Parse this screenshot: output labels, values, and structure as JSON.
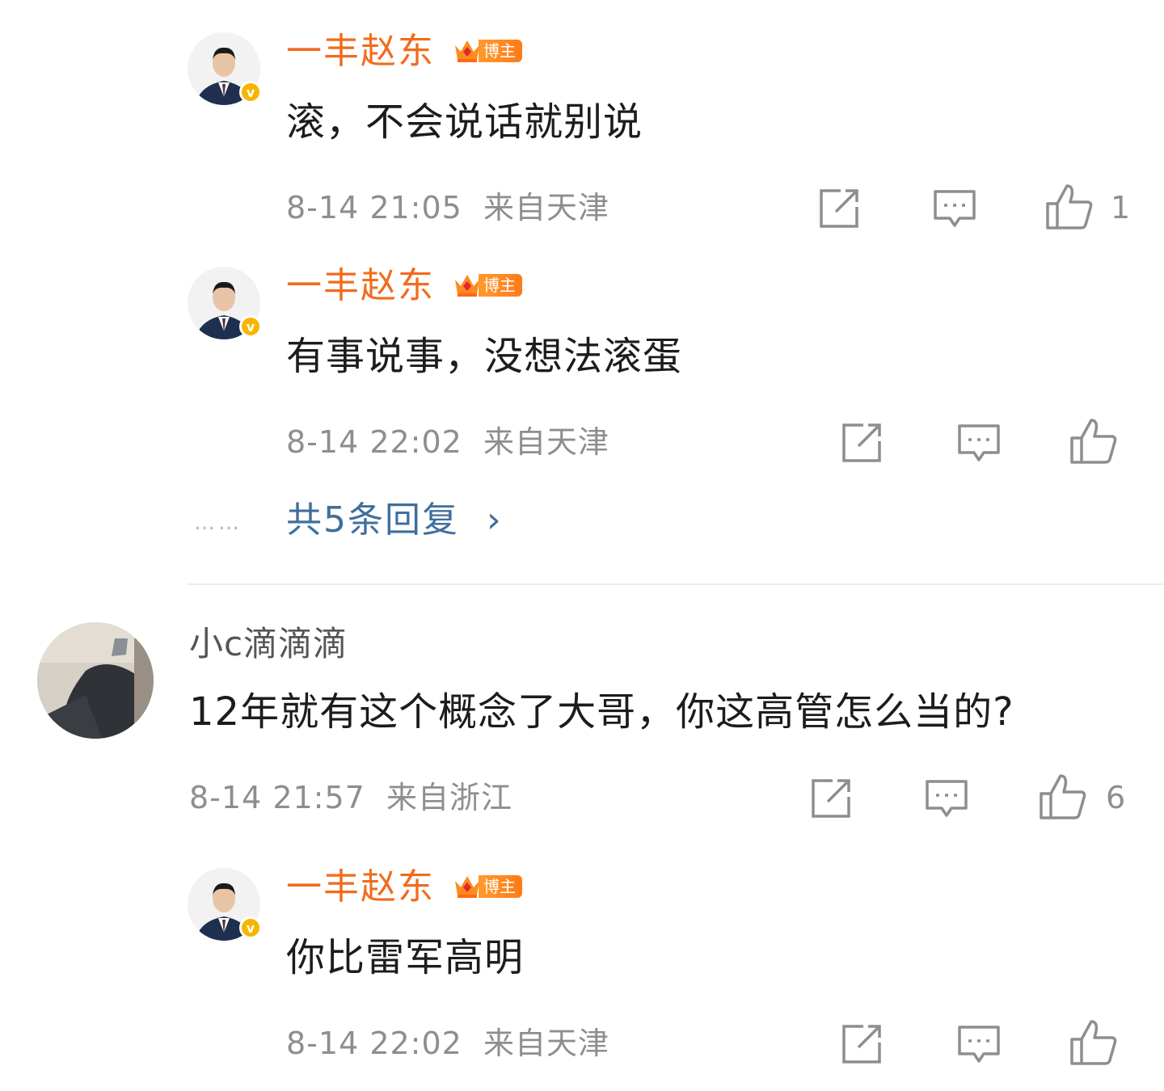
{
  "replies_top": [
    {
      "author": "一丰赵东",
      "badge": "博主",
      "text": "滚，不会说话就别说",
      "time": "8-14 21:05",
      "location": "来自天津",
      "like_count": "1"
    },
    {
      "author": "一丰赵东",
      "badge": "博主",
      "text": "有事说事，没想法滚蛋",
      "time": "8-14 22:02",
      "location": "来自天津",
      "like_count": ""
    }
  ],
  "more_replies": {
    "dots": "……",
    "label": "共5条回复",
    "arrow": "›"
  },
  "comment": {
    "author": "小c滴滴滴",
    "text": "12年就有这个概念了大哥，你这高管怎么当的?",
    "time": "8-14 21:57",
    "location": "来自浙江",
    "like_count": "6"
  },
  "reply_bottom": {
    "author": "一丰赵东",
    "badge": "博主",
    "text": "你比雷军高明",
    "time": "8-14 22:02",
    "location": "来自天津"
  },
  "colors": {
    "author_orange": "#f26b1d",
    "link_blue": "#3f6f9c",
    "meta_gray": "#8e8e8e",
    "verified_gold": "#f7b500"
  },
  "icons": [
    "share-icon",
    "comment-icon",
    "like-icon",
    "verified-icon",
    "crown-icon",
    "chevron-right-icon"
  ]
}
